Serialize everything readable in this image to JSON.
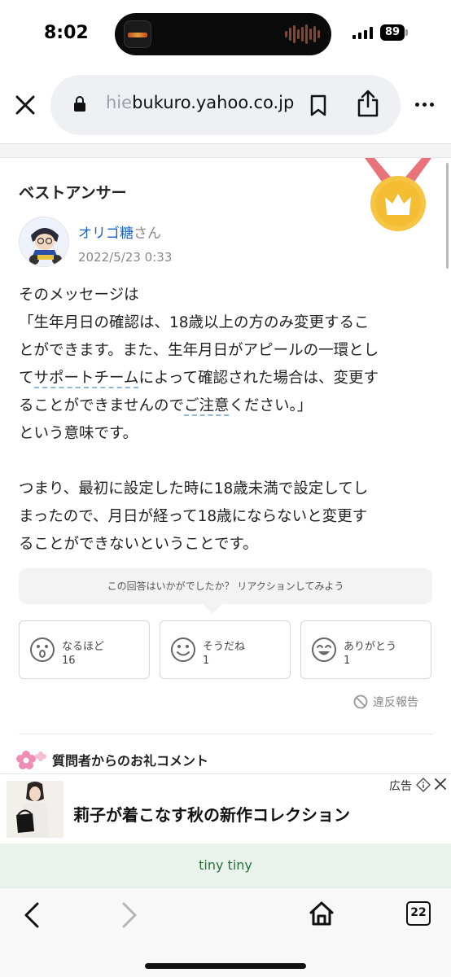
{
  "status_bar": {
    "time": "8:02",
    "battery": "89"
  },
  "browser": {
    "url_faded": "hie",
    "url_main": "bukuro.yahoo.co.jp",
    "tab_count": "22"
  },
  "answer_section": {
    "heading": "ベストアンサー",
    "user_name": "オリゴ糖",
    "user_suffix": "さん",
    "date": "2022/5/23 0:33",
    "lines": {
      "l1": "そのメッセージは",
      "l2": "「生年月日の確認は、18歳以上の方のみ変更するこ",
      "l3": "とができます。また、生年月日がアピールの一環とし",
      "l4a": "て",
      "l4b": "サポートチーム",
      "l4c": "によって確認された場合は、変更す",
      "l5a": "ることができませんので",
      "l5b": "ご注意",
      "l5c": "ください。」",
      "l6": "という意味です。",
      "l8": "つまり、最初に設定した時に18歳未満で設定してし",
      "l9": "まったので、月日が経って18歳にならないと変更す",
      "l10": "ることができないということです。"
    },
    "reaction_prompt": "この回答はいかがでしたか？ リアクションしてみよう",
    "reactions": [
      {
        "label": "なるほど",
        "count": "16"
      },
      {
        "label": "そうだね",
        "count": "1"
      },
      {
        "label": "ありがとう",
        "count": "1"
      }
    ],
    "report": "違反報告",
    "thanks_heading": "質問者からのお礼コメント"
  },
  "ad": {
    "label": "広告",
    "text": "莉子が着こなす秋の新作コレクション"
  },
  "tiny_banner": "tiny tiny",
  "colors": {
    "link": "#1a62c8",
    "medal_gold": "#f6c544",
    "ribbon": "#e9737b",
    "banner_bg": "#e9f3ec"
  }
}
